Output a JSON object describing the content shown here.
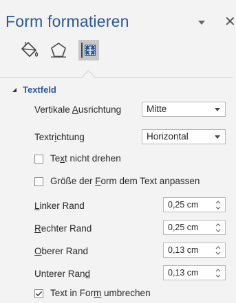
{
  "pane": {
    "title": "Form formatieren",
    "dropdown_icon": "triangle-down-icon",
    "close_glyph": "✕"
  },
  "tabs": [
    {
      "name": "fill-and-line",
      "icon": "paint-bucket-icon",
      "selected": false
    },
    {
      "name": "effects",
      "icon": "pentagon-icon",
      "selected": false
    },
    {
      "name": "size-and-properties",
      "icon": "layout-properties-icon",
      "selected": true
    }
  ],
  "section": {
    "title": "Textfeld",
    "expanded": true
  },
  "fields": {
    "vertical_alignment": {
      "label_pre": "Vertikale ",
      "label_u": "A",
      "label_post": "usrichtung",
      "value": "Mitte"
    },
    "text_direction": {
      "label_pre": "Textr",
      "label_u": "i",
      "label_post": "chtung",
      "value": "Horizontal"
    },
    "no_rotate": {
      "label_pre": "Te",
      "label_u": "x",
      "label_post": "t nicht drehen",
      "checked": false
    },
    "autofit": {
      "label_pre": "Größe der ",
      "label_u": "F",
      "label_post": "orm dem Text anpassen",
      "checked": false
    },
    "left_margin": {
      "label_pre": "",
      "label_u": "L",
      "label_post": "inker Rand",
      "value": "0,25 cm"
    },
    "right_margin": {
      "label_pre": "",
      "label_u": "R",
      "label_post": "echter Rand",
      "value": "0,25 cm"
    },
    "top_margin": {
      "label_pre": "",
      "label_u": "O",
      "label_post": "berer Rand",
      "value": "0,13 cm"
    },
    "bottom_margin": {
      "label_pre": "Unterer Ran",
      "label_u": "d",
      "label_post": "",
      "value": "0,13 cm"
    },
    "wrap_text": {
      "label_pre": "Text in For",
      "label_u": "m",
      "label_post": " umbrechen",
      "checked": true
    }
  },
  "colors": {
    "accent": "#2b579a",
    "background": "#f3f3f3",
    "selected_tab": "#c7c7c7"
  }
}
